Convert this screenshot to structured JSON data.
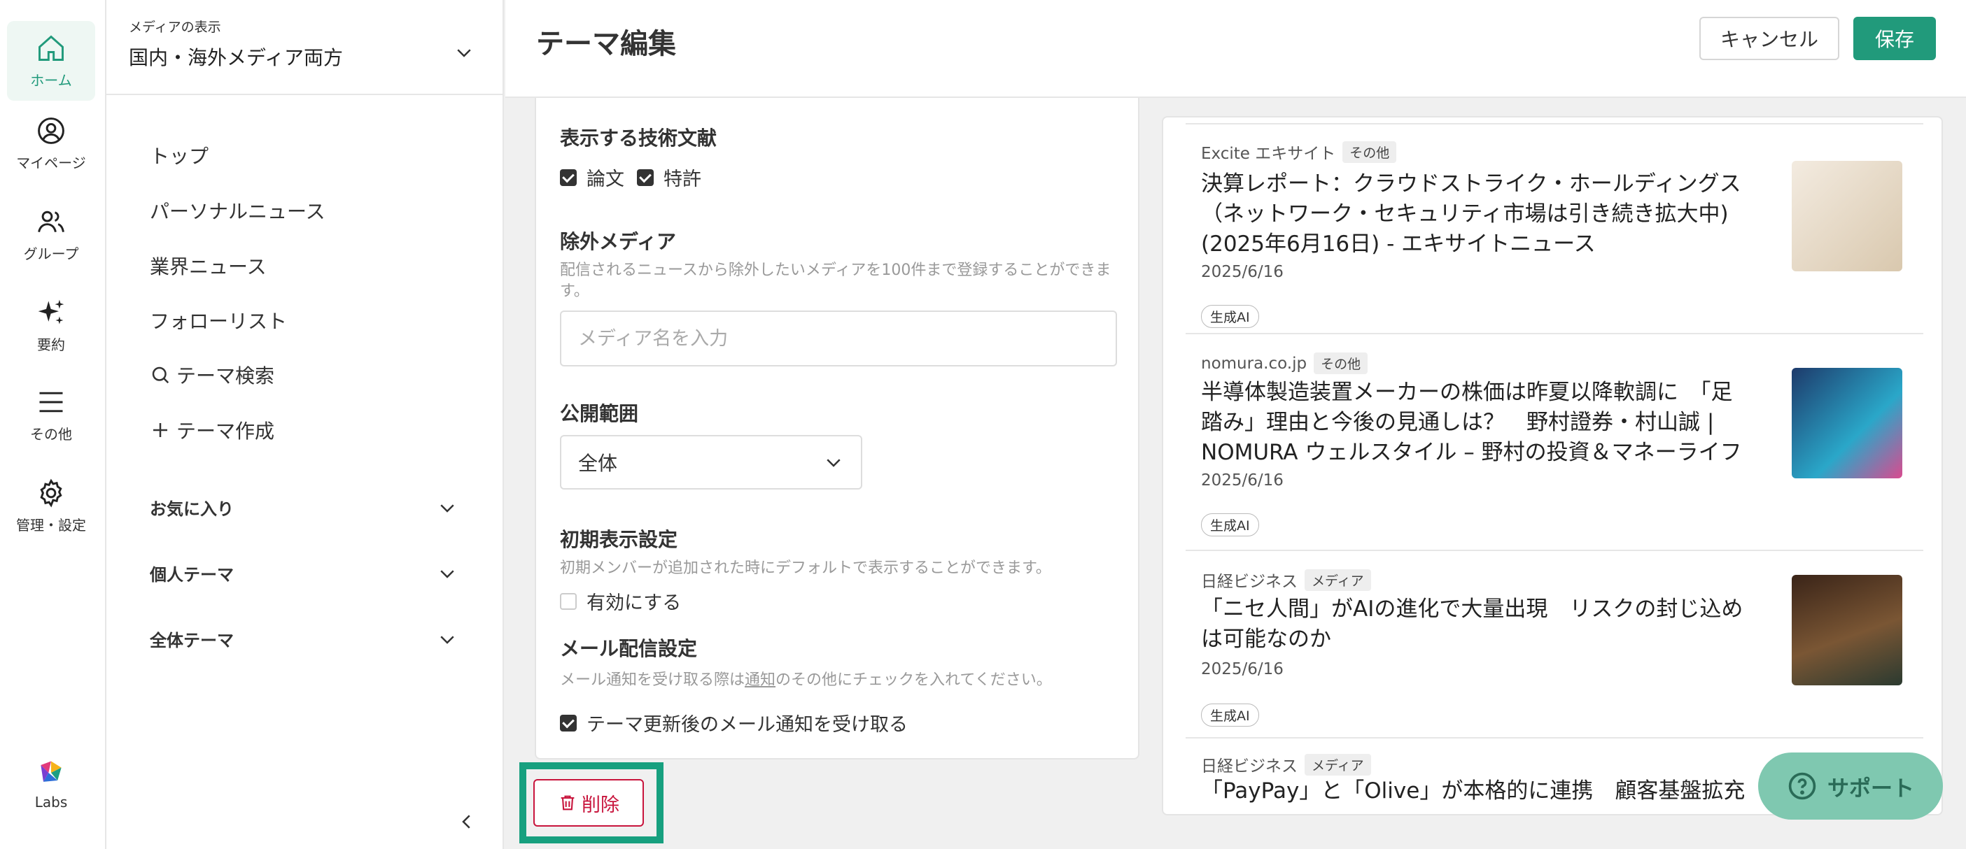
{
  "rail": {
    "items": [
      {
        "label": "ホーム",
        "icon": "home-icon"
      },
      {
        "label": "マイページ",
        "icon": "user-circle-icon"
      },
      {
        "label": "グループ",
        "icon": "group-icon"
      },
      {
        "label": "要約",
        "icon": "sparkle-icon"
      },
      {
        "label": "その他",
        "icon": "menu-icon"
      },
      {
        "label": "管理・設定",
        "icon": "gear-icon"
      }
    ],
    "labs": "Labs"
  },
  "sidebar": {
    "media_label": "メディアの表示",
    "media_value": "国内・海外メディア両方",
    "nav": [
      "トップ",
      "パーソナルニュース",
      "業界ニュース",
      "フォローリスト",
      "テーマ検索",
      "テーマ作成"
    ],
    "groups": [
      "お気に入り",
      "個人テーマ",
      "全体テーマ"
    ]
  },
  "header": {
    "title": "テーマ編集",
    "cancel": "キャンセル",
    "save": "保存"
  },
  "settings": {
    "docs_title": "表示する技術文献",
    "docs_paper": "論文",
    "docs_patent": "特許",
    "exclude_title": "除外メディア",
    "exclude_desc": "配信されるニュースから除外したいメディアを100件まで登録することができます。",
    "exclude_placeholder": "メディア名を入力",
    "scope_title": "公開範囲",
    "scope_value": "全体",
    "initial_title": "初期表示設定",
    "initial_desc": "初期メンバーが追加された時にデフォルトで表示することができます。",
    "initial_check": "有効にする",
    "mail_title": "メール配信設定",
    "mail_desc_pre": "メール通知を受け取る際は",
    "mail_desc_link": "通知",
    "mail_desc_post": "のその他にチェックを入れてください。",
    "mail_check": "テーマ更新後のメール通知を受け取る"
  },
  "delete_label": "削除",
  "news": [
    {
      "source": "Excite エキサイト",
      "category": "その他",
      "title": "決算レポート：クラウドストライク・ホールディングス（ネットワーク・セキュリティ市場は引き続き拡大中)(2025年6月16日) - エキサイトニュース",
      "date": "2025/6/16",
      "tag": "生成AI",
      "thumb_color": "#e9dccb"
    },
    {
      "source": "nomura.co.jp",
      "category": "その他",
      "title": "半導体製造装置メーカーの株価は昨夏以降軟調に　「足踏み」理由と今後の見通しは？　野村證券・村山誠 | NOMURA ウェルスタイル – 野村の投資＆マネーライフ",
      "date": "2025/6/16",
      "tag": "生成AI",
      "thumb_color": "#1d3a6b"
    },
    {
      "source": "日経ビジネス",
      "category": "メディア",
      "title": "「ニセ人間」がAIの進化で大量出現　リスクの封じ込めは可能なのか",
      "date": "2025/6/16",
      "tag": "生成AI",
      "thumb_color": "#5a3a26"
    },
    {
      "source": "日経ビジネス",
      "category": "メディア",
      "title": "「PayPay」と「Olive」が本格的に連携　顧客基盤拡充"
    }
  ],
  "support": "サポート",
  "colors": {
    "accent": "#219a7b",
    "danger": "#c8143c",
    "highlight": "#17a07f"
  }
}
